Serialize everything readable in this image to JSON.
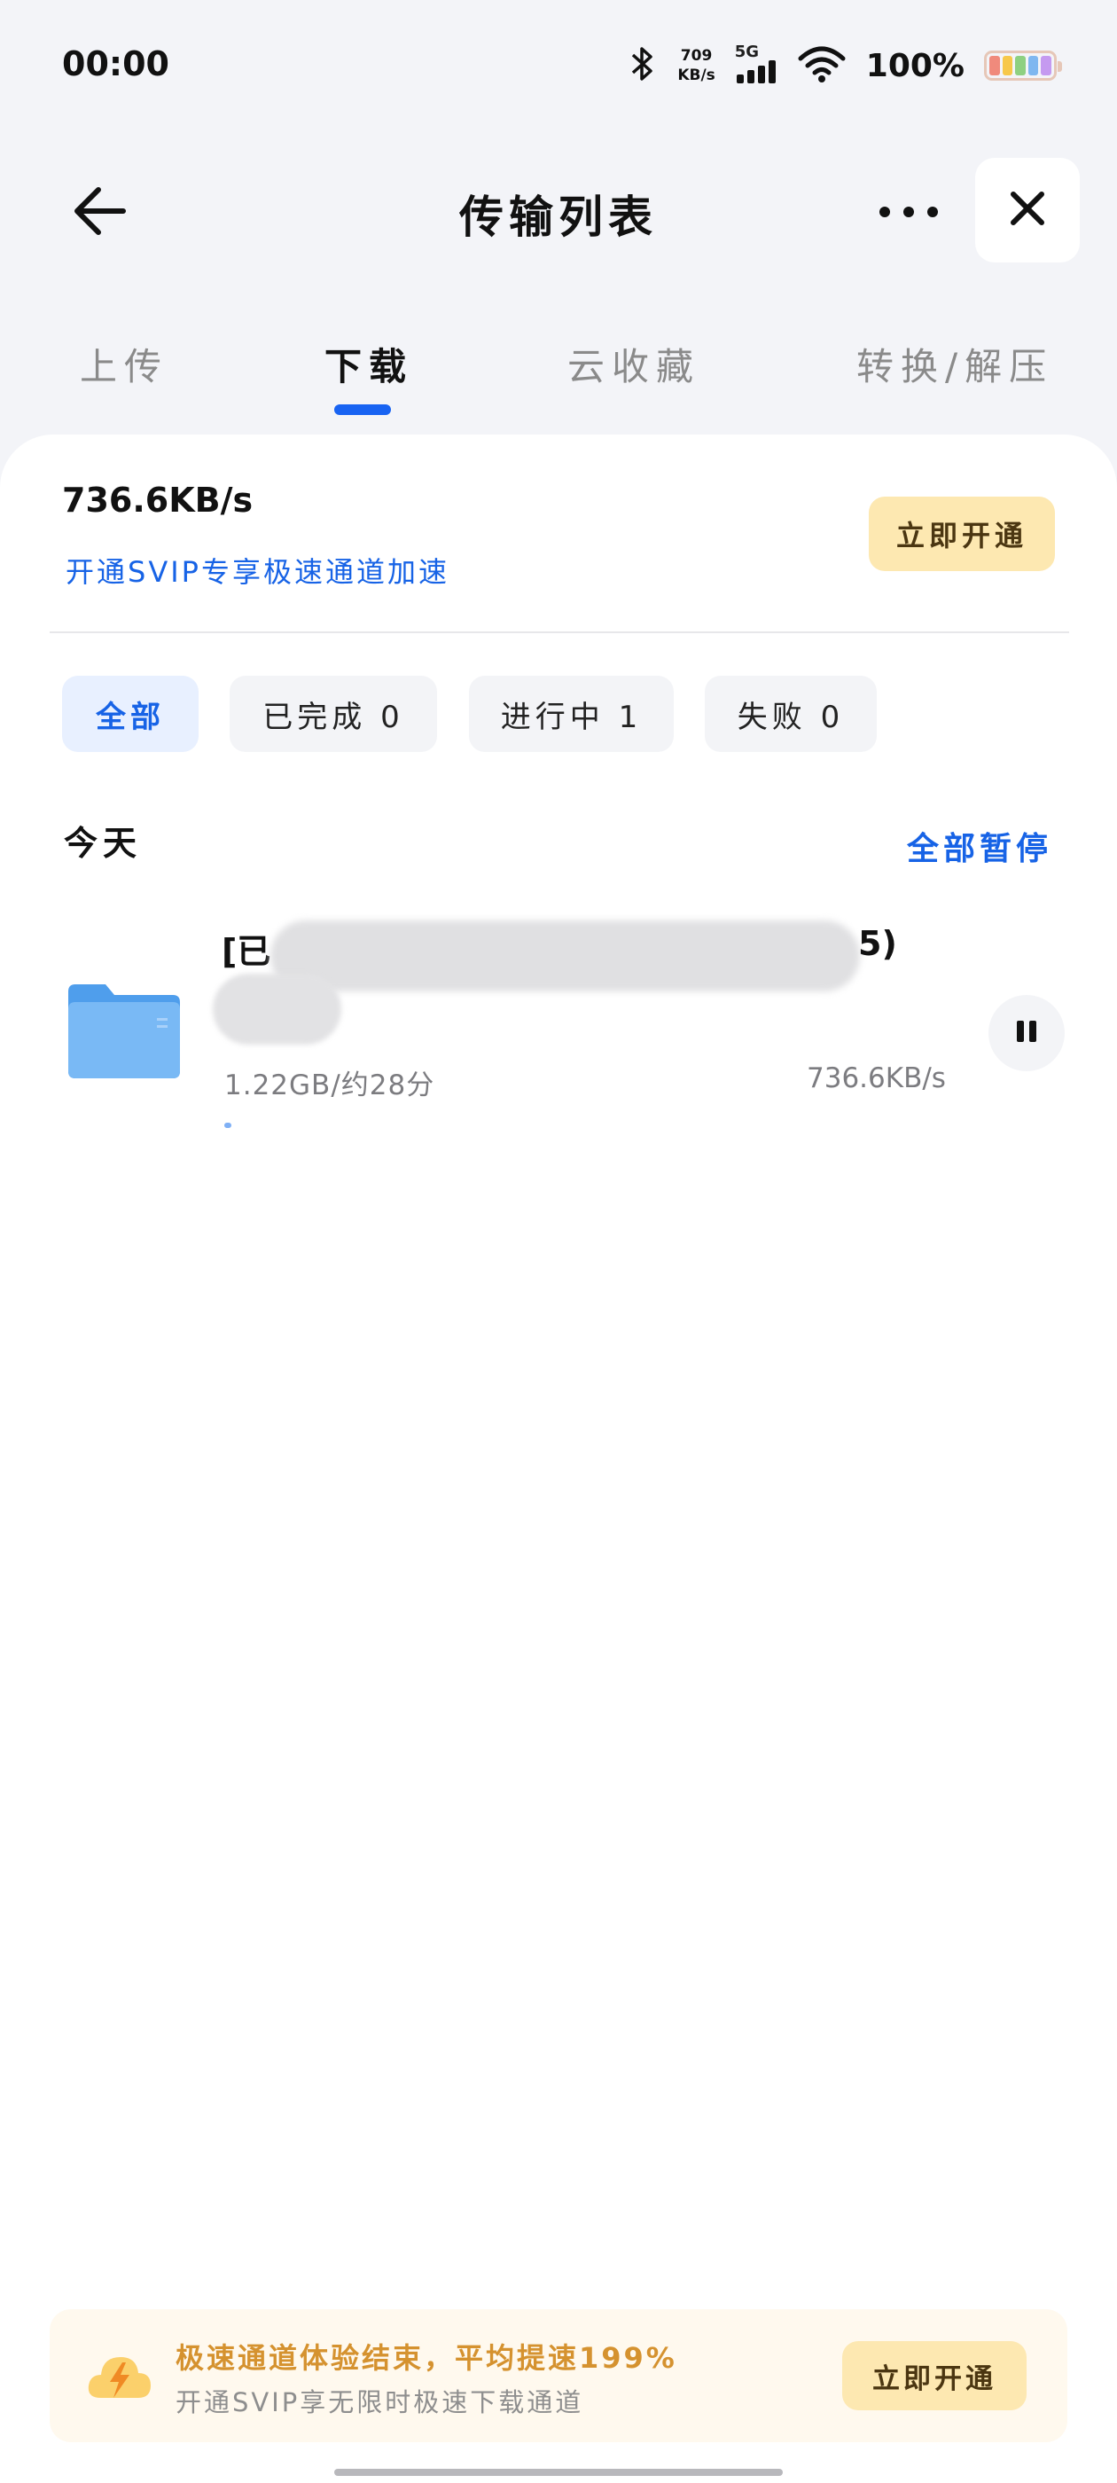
{
  "status_bar": {
    "time": "00:00",
    "net_speed_value": "709",
    "net_speed_unit": "KB/s",
    "network_type": "5G",
    "battery": "100%",
    "icons": [
      "bluetooth-icon",
      "signal-icon",
      "wifi-icon",
      "battery-icon"
    ]
  },
  "header": {
    "title": "传输列表",
    "back_icon": "arrow-left-icon",
    "more_icon": "more-icon",
    "close_icon": "close-icon"
  },
  "tabs": [
    {
      "label": "上传",
      "active": false
    },
    {
      "label": "下载",
      "active": true
    },
    {
      "label": "云收藏",
      "active": false
    },
    {
      "label": "转换/解压",
      "active": false
    }
  ],
  "speed": {
    "current": "736.6KB/s",
    "svip_link": "开通SVIP专享极速通道加速",
    "open_button": "立即开通"
  },
  "filters": [
    {
      "label": "全部",
      "active": true
    },
    {
      "label": "已完成 0",
      "active": false
    },
    {
      "label": "进行中 1",
      "active": false
    },
    {
      "label": "失败 0",
      "active": false
    }
  ],
  "section": {
    "title": "今天",
    "pause_all": "全部暂停"
  },
  "file": {
    "name_start": "[已",
    "name_end": "5)",
    "meta": "1.22GB/约28分",
    "speed": "736.6KB/s",
    "progress": 0.01,
    "icon": "folder-icon",
    "pause_icon": "pause-icon"
  },
  "banner": {
    "title": "极速通道体验结束，平均提速199%",
    "subtitle": "开通SVIP享无限时极速下载通道",
    "button": "立即开通",
    "icon": "cloud-lightning-icon"
  },
  "colors": {
    "accent": "#1863f2",
    "link": "#1763e6",
    "vip_button": "#fde8b1",
    "banner_title": "#d5922f"
  }
}
